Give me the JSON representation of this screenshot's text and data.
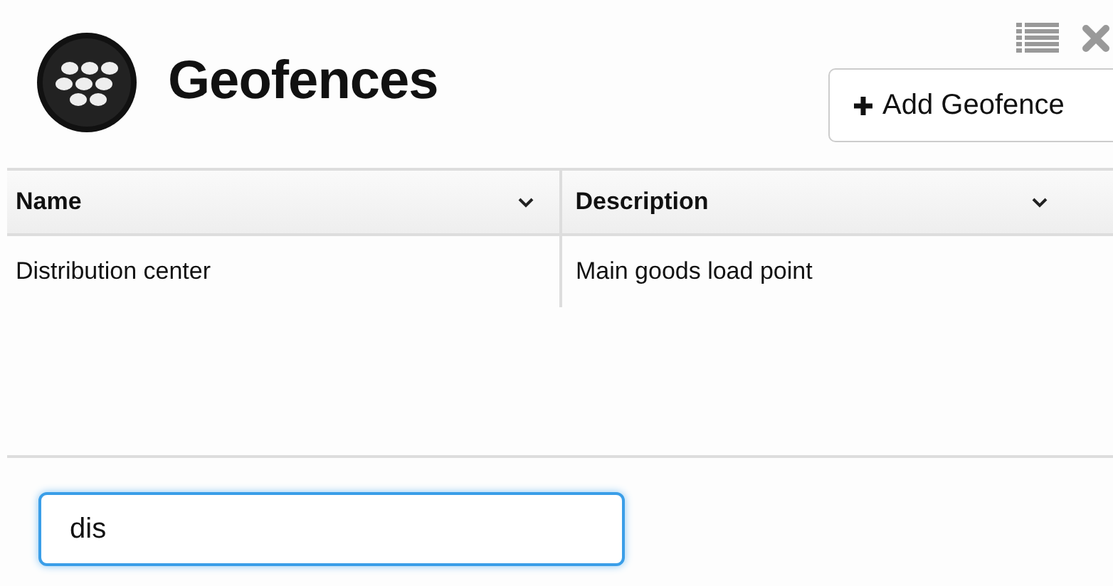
{
  "header": {
    "title": "Geofences",
    "add_button": "Add Geofence"
  },
  "table": {
    "columns": [
      {
        "label": "Name"
      },
      {
        "label": "Description"
      }
    ],
    "rows": [
      [
        "Distribution center",
        "Main goods load point"
      ]
    ]
  },
  "search": {
    "value": "dis"
  }
}
